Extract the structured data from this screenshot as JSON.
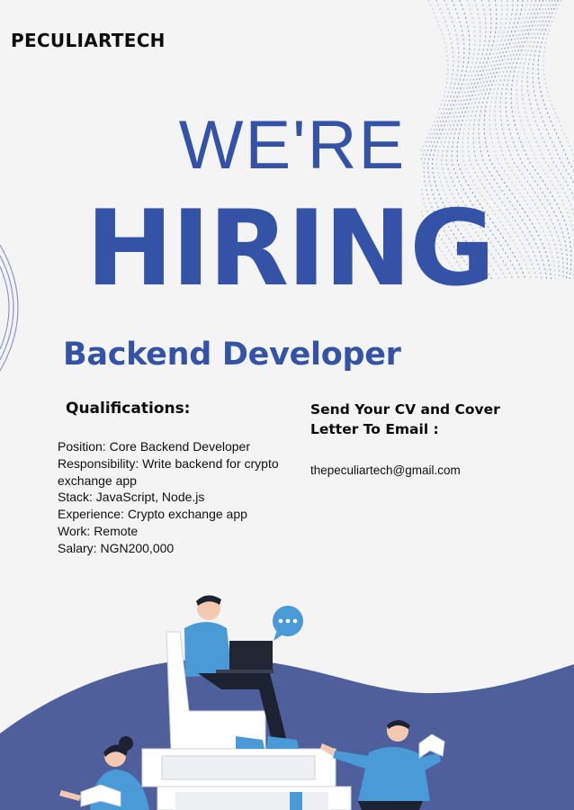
{
  "brand": "PECULIARTECH",
  "headline": {
    "line1": "WE'RE",
    "line2": "HIRING"
  },
  "role": "Backend Developer",
  "qualifications": {
    "title": "Qualifications:",
    "items": [
      "Position: Core Backend Developer",
      "Responsibility: Write backend for crypto exchange app",
      "Stack: JavaScript, Node.js",
      "Experience: Crypto exchange app",
      "Work: Remote",
      "Salary: NGN200,000"
    ]
  },
  "contact": {
    "title": "Send Your CV and Cover Letter To Email :",
    "email": "thepeculiartech@gmail.com"
  },
  "colors": {
    "accent": "#3553a6",
    "wave": "#4e5f9c",
    "shirt": "#4a9ad8",
    "background": "#f4f4f5"
  },
  "icons": [
    "dotted-wave-pattern",
    "concentric-arcs",
    "speech-bubble-icon",
    "laptop-icon",
    "book-icon"
  ]
}
